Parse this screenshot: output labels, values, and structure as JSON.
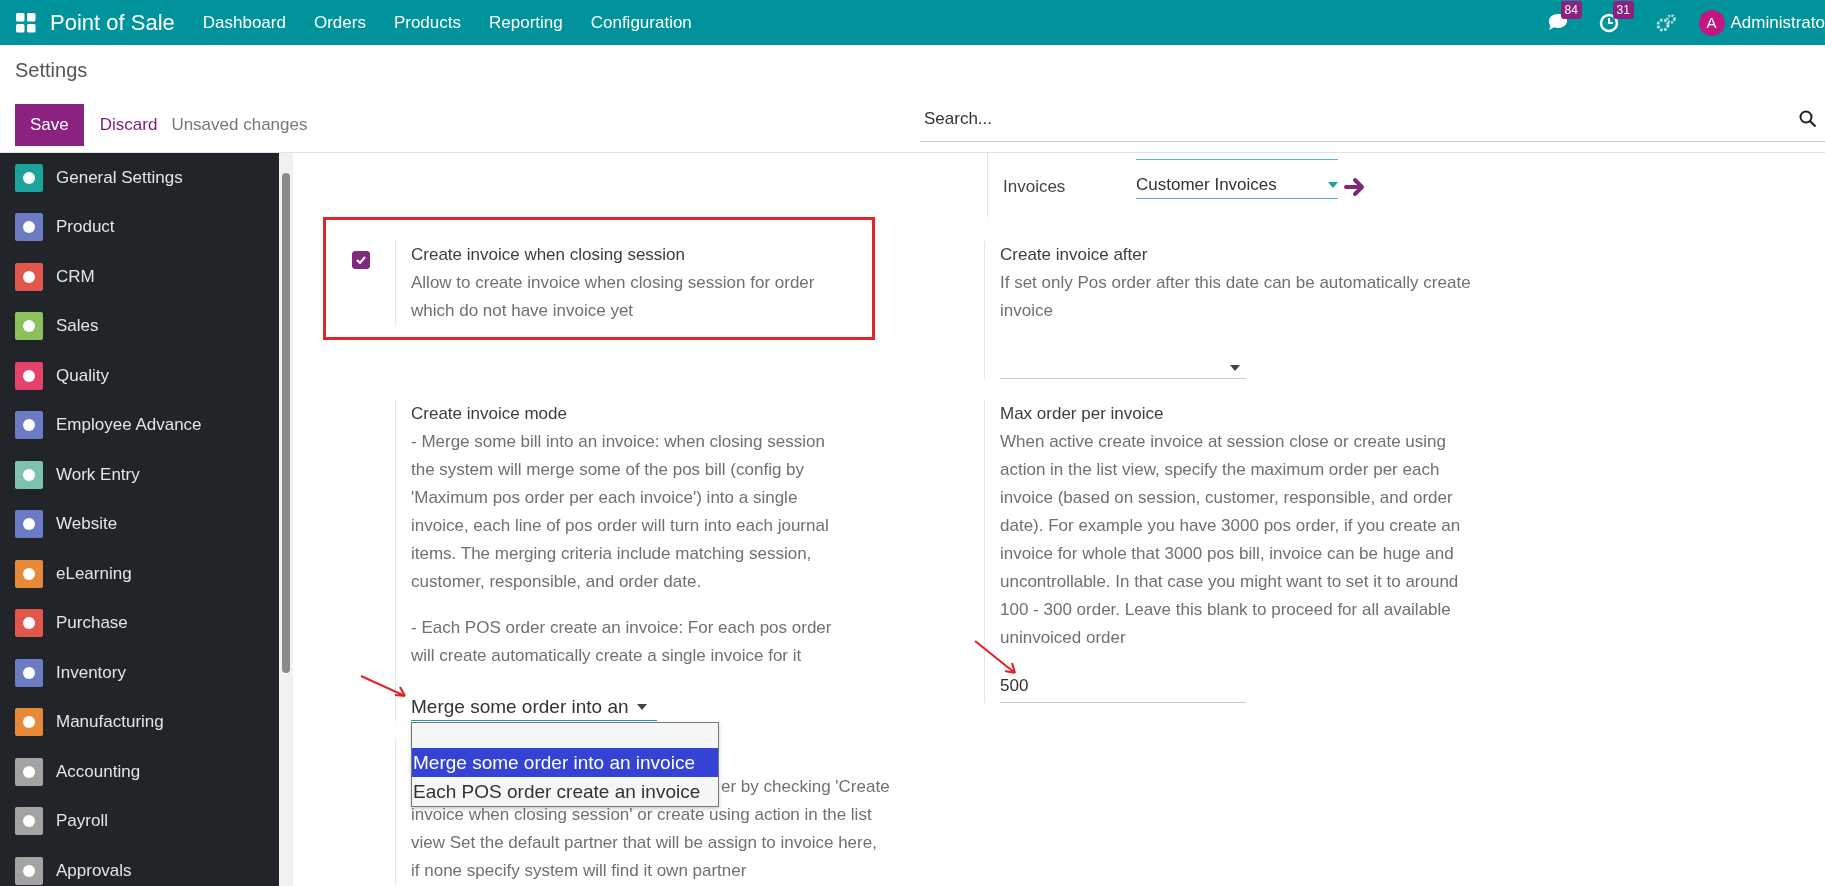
{
  "topbar": {
    "app_title": "Point of Sale",
    "menu": [
      "Dashboard",
      "Orders",
      "Products",
      "Reporting",
      "Configuration"
    ],
    "messages_badge": "84",
    "activities_badge": "31",
    "user_initial": "A",
    "user_name": "Administrato"
  },
  "control_panel": {
    "title": "Settings",
    "search_placeholder": "Search...",
    "buttons": [
      {
        "label": "Save",
        "kind": "primary"
      },
      {
        "label": "Discard",
        "kind": "link"
      }
    ],
    "status": "Unsaved changes"
  },
  "sidebar": {
    "items": [
      {
        "label": "General Settings",
        "color": "#1ba39c",
        "selected": false
      },
      {
        "label": "Product",
        "color": "#6b7bc4",
        "selected": false
      },
      {
        "label": "CRM",
        "color": "#e2574c",
        "selected": false
      },
      {
        "label": "Sales",
        "color": "#8cc15d",
        "selected": false
      },
      {
        "label": "Quality",
        "color": "#e8416b",
        "selected": false
      },
      {
        "label": "Employee Advance",
        "color": "#6b7bc4",
        "selected": false
      },
      {
        "label": "Work Entry",
        "color": "#7dc3ad",
        "selected": false
      },
      {
        "label": "Website",
        "color": "#6b7bc4",
        "selected": false
      },
      {
        "label": "eLearning",
        "color": "#e8893a",
        "selected": false
      },
      {
        "label": "Purchase",
        "color": "#e2574c",
        "selected": false
      },
      {
        "label": "Inventory",
        "color": "#6b7bc4",
        "selected": false
      },
      {
        "label": "Manufacturing",
        "color": "#e8893a",
        "selected": false
      },
      {
        "label": "Accounting",
        "color": "#a3a3a3",
        "selected": false
      },
      {
        "label": "Payroll",
        "color": "#a3a3a3",
        "selected": false
      },
      {
        "label": "Approvals",
        "color": "#a3a3a3",
        "selected": false
      }
    ]
  },
  "journals": [
    {
      "label": "Invoices",
      "value": "Customer Invoices"
    }
  ],
  "settings": {
    "left": [
      {
        "kind": "checkbox",
        "title": "Create invoice when closing session",
        "description": [
          "Allow to create invoice when closing session for order which do not have invoice yet"
        ],
        "checked": true,
        "highlighted": true
      },
      {
        "kind": "select",
        "title": "Create invoice mode",
        "description": [
          "- Merge some bill into an invoice: when closing session the system will merge some of the pos bill (config by 'Maximum pos order per each invoice') into a single invoice, each line of pos order will turn into each journal items. The merging criteria include matching session, customer, responsible, and order date.",
          "- Each POS order create an invoice: For each pos order will create automatically create a single invoice for it"
        ],
        "value": "Merge some order into an",
        "open": true,
        "options": [
          {
            "label": "Merge some order into an invoice",
            "selected": true
          },
          {
            "label": "Each POS order create an invoice",
            "selected": false
          }
        ]
      },
      {
        "kind": "text",
        "text": [
          "er by checking 'Create",
          "invoice when closing session' or create using action in the list view Set the default partner that will be assign to invoice here, if none specify system will find it own partner"
        ]
      }
    ],
    "right": [
      {
        "kind": "date",
        "title": "Create invoice after",
        "description": [
          "If set only Pos order after this date can be automatically create invoice"
        ]
      },
      {
        "kind": "number",
        "title": "Max order per invoice",
        "description": [
          "When active create invoice at session close or create using action in the list view, specify the maximum order per each invoice (based on session, customer, responsible, and order date). For example you have 3000 pos order, if you create an invoice for whole that 3000 pos bill, invoice can be huge and uncontrollable. In that case you might want to set it to around 100 - 300 order. Leave this blank to proceed for all available uninvoiced order"
        ],
        "value": "500"
      }
    ]
  }
}
